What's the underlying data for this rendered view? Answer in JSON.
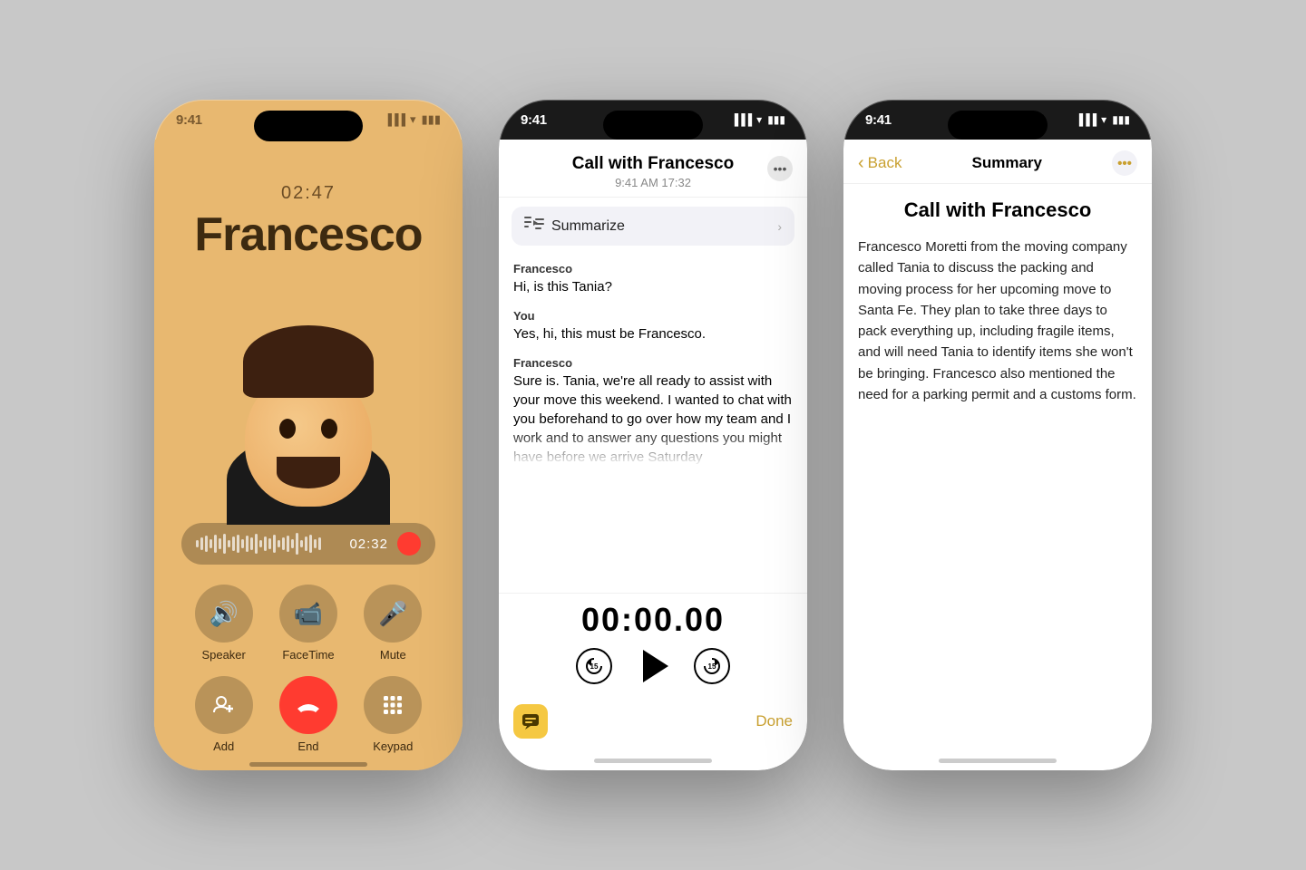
{
  "phone1": {
    "status_time": "9:41",
    "call_timer": "02:47",
    "call_name": "Francesco",
    "rec_time": "02:32",
    "buttons_row1": [
      {
        "icon": "🔊",
        "label": "Speaker"
      },
      {
        "icon": "📹",
        "label": "FaceTime"
      },
      {
        "icon": "🎤",
        "label": "Mute"
      }
    ],
    "buttons_row2": [
      {
        "icon": "👤",
        "label": "Add"
      },
      {
        "icon": "📞",
        "label": "End",
        "red": true
      },
      {
        "icon": "⌨️",
        "label": "Keypad"
      }
    ]
  },
  "phone2": {
    "status_time": "9:41",
    "title": "Call with Francesco",
    "subtitle": "9:41 AM  17:32",
    "summarize_label": "Summarize",
    "messages": [
      {
        "speaker": "Francesco",
        "text": "Hi, is this Tania?",
        "fade": false
      },
      {
        "speaker": "You",
        "text": "Yes, hi, this must be Francesco.",
        "fade": false
      },
      {
        "speaker": "Francesco",
        "text": "Sure is. Tania, we're all ready to assist with your move this weekend. I wanted to chat with you beforehand to go over how my team and I work and to answer any questions you might have before we arrive Saturday",
        "fade": true
      }
    ],
    "playback_time": "00:00.00",
    "done_label": "Done"
  },
  "phone3": {
    "status_time": "9:41",
    "back_label": "Back",
    "nav_title": "Summary",
    "title": "Call with Francesco",
    "summary_text": "Francesco Moretti from the moving company called Tania to discuss the packing and moving process for her upcoming move to Santa Fe. They plan to take three days to pack everything up, including fragile items, and will need Tania to identify items she won't be bringing. Francesco also mentioned the need for a parking permit and a customs form."
  }
}
